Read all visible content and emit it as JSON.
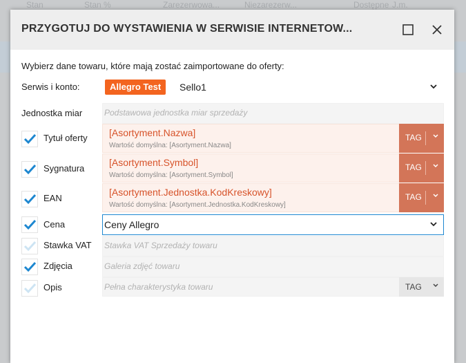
{
  "background": {
    "columns": [
      "Stan",
      "Stan %",
      "Zarezerwowa...",
      "Niezarezerw...",
      "Dostępne",
      "J.m."
    ]
  },
  "dialog": {
    "title": "PRZYGOTUJ DO WYSTAWIENIA W SERWISIE INTERNETOW...",
    "instruction": "Wybierz dane towaru, które mają zostać zaimportowane do oferty:",
    "serwis": {
      "label": "Serwis i konto:",
      "badge": "Allegro Test",
      "value": "Sello1"
    },
    "jednostka": {
      "label": "Jednostka miar",
      "placeholder": "Podstawowa jednostka miar sprzedaży"
    },
    "tytul": {
      "label": "Tytuł oferty",
      "value": "[Asortyment.Nazwa]",
      "default": "Wartość domyślna: [Asortyment.Nazwa]",
      "tag": "TAG",
      "checked": true
    },
    "sygnatura": {
      "label": "Sygnatura",
      "value": "[Asortyment.Symbol]",
      "default": "Wartość domyślna: [Asortyment.Symbol]",
      "tag": "TAG",
      "checked": true
    },
    "ean": {
      "label": "EAN",
      "value": "[Asortyment.Jednostka.KodKreskowy]",
      "default": "Wartość domyślna: [Asortyment.Jednostka.KodKreskowy]",
      "tag": "TAG",
      "checked": true
    },
    "cena": {
      "label": "Cena",
      "value": "Ceny Allegro",
      "checked": true
    },
    "vat": {
      "label": "Stawka VAT",
      "placeholder": "Stawka VAT Sprzedaży towaru",
      "checked": false
    },
    "zdjecia": {
      "label": "Zdjęcia",
      "placeholder": "Galeria zdjęć towaru",
      "checked": true
    },
    "opis": {
      "label": "Opis",
      "placeholder": "Pełna charakterystyka towaru",
      "tag": "TAG",
      "checked": false
    }
  },
  "colors": {
    "accent_blue": "#1d87d0",
    "allegro_orange": "#f3641f",
    "tag_button": "#d37558",
    "tag_text": "#d7532a"
  }
}
